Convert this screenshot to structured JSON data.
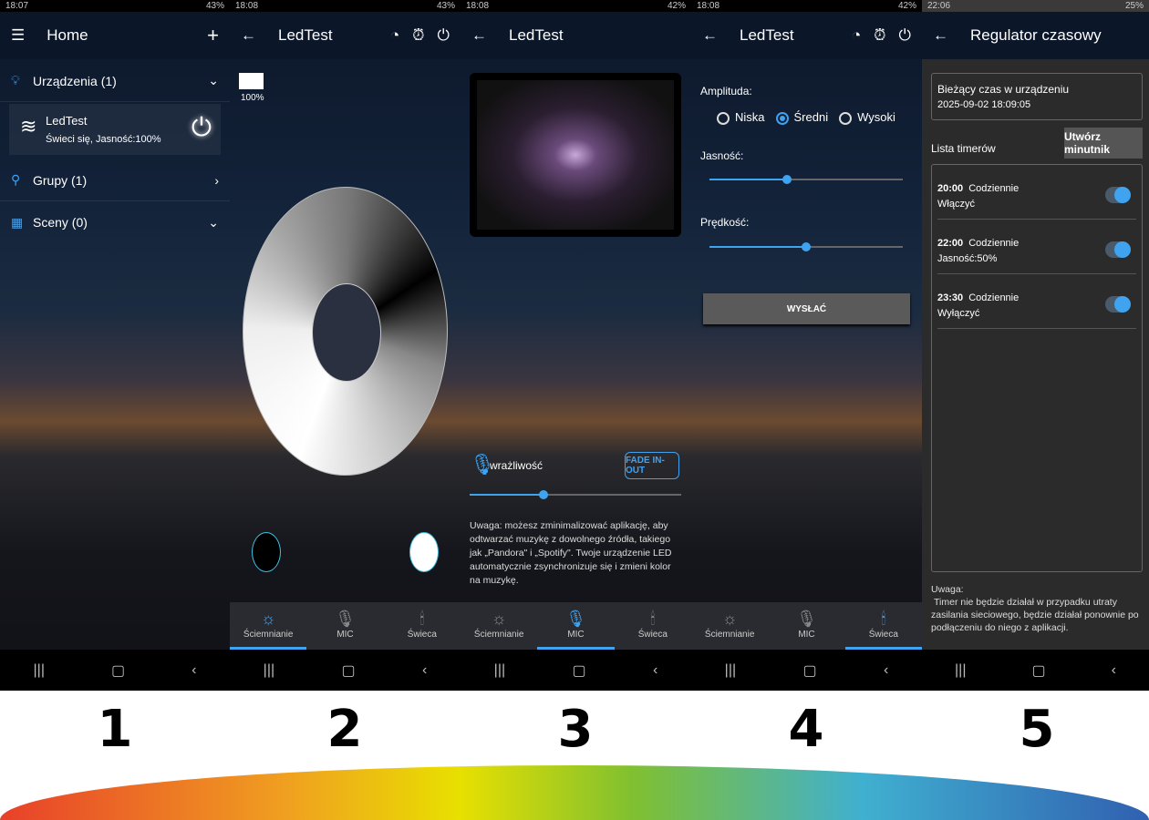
{
  "panels": [
    {
      "status": {
        "time": "18:07",
        "right": "43%"
      },
      "title": "Home"
    },
    {
      "status": {
        "time": "18:08",
        "right": "43%"
      },
      "title": "LedTest",
      "brightness_label": "100%"
    },
    {
      "status": {
        "time": "18:08",
        "right": "42%"
      },
      "title": "LedTest"
    },
    {
      "status": {
        "time": "18:08",
        "right": "42%"
      },
      "title": "LedTest"
    },
    {
      "status": {
        "time": "22:06",
        "right": "25%"
      },
      "title": "Regulator czasowy"
    }
  ],
  "home": {
    "devices_label": "Urządzenia (1)",
    "device": {
      "name": "LedTest",
      "status": "Świeci się, Jasność:100%"
    },
    "groups_label": "Grupy (1)",
    "scenes_label": "Sceny (0)"
  },
  "tabs": [
    "Ściemnianie",
    "MIC",
    "Świeca"
  ],
  "mic": {
    "sensitivity_label": "wrażliwość",
    "fade_button": "FADE IN-OUT",
    "sensitivity_value": 0.35,
    "note": "Uwaga: możesz zminimalizować aplikację, aby odtwarzać muzykę z dowolnego źródła, takiego jak „Pandora\" i „Spotify\". Twoje urządzenie LED automatycznie zsynchronizuje się i zmieni kolor na muzykę."
  },
  "candle": {
    "amplitude_label": "Amplituda:",
    "options": [
      "Niska",
      "Średni",
      "Wysoki"
    ],
    "selected": "Średni",
    "brightness_label": "Jasność:",
    "brightness_value": 0.4,
    "speed_label": "Prędkość:",
    "speed_value": 0.5,
    "send_button": "WYSŁAĆ"
  },
  "timer": {
    "current_time_label": "Bieżący czas w urządzeniu",
    "current_time": "2025-09-02 18:09:05",
    "list_label": "Lista timerów",
    "create_button": "Utwórz minutnik",
    "timers": [
      {
        "time": "20:00",
        "repeat": "Codziennie",
        "action": "Włączyć",
        "enabled": true
      },
      {
        "time": "22:00",
        "repeat": "Codziennie",
        "action": "Jasność:50%",
        "enabled": true
      },
      {
        "time": "23:30",
        "repeat": "Codziennie",
        "action": "Wyłączyć",
        "enabled": true
      }
    ],
    "note_title": "Uwaga:",
    "note": "Timer nie będzie działał w przypadku utraty zasilania sieciowego, będzie działał ponownie po podłączeniu do niego z aplikacji."
  },
  "step_numbers": [
    "1",
    "2",
    "3",
    "4",
    "5"
  ],
  "colors": {
    "accent": "#3fa3f0",
    "header": "#0b1628"
  }
}
